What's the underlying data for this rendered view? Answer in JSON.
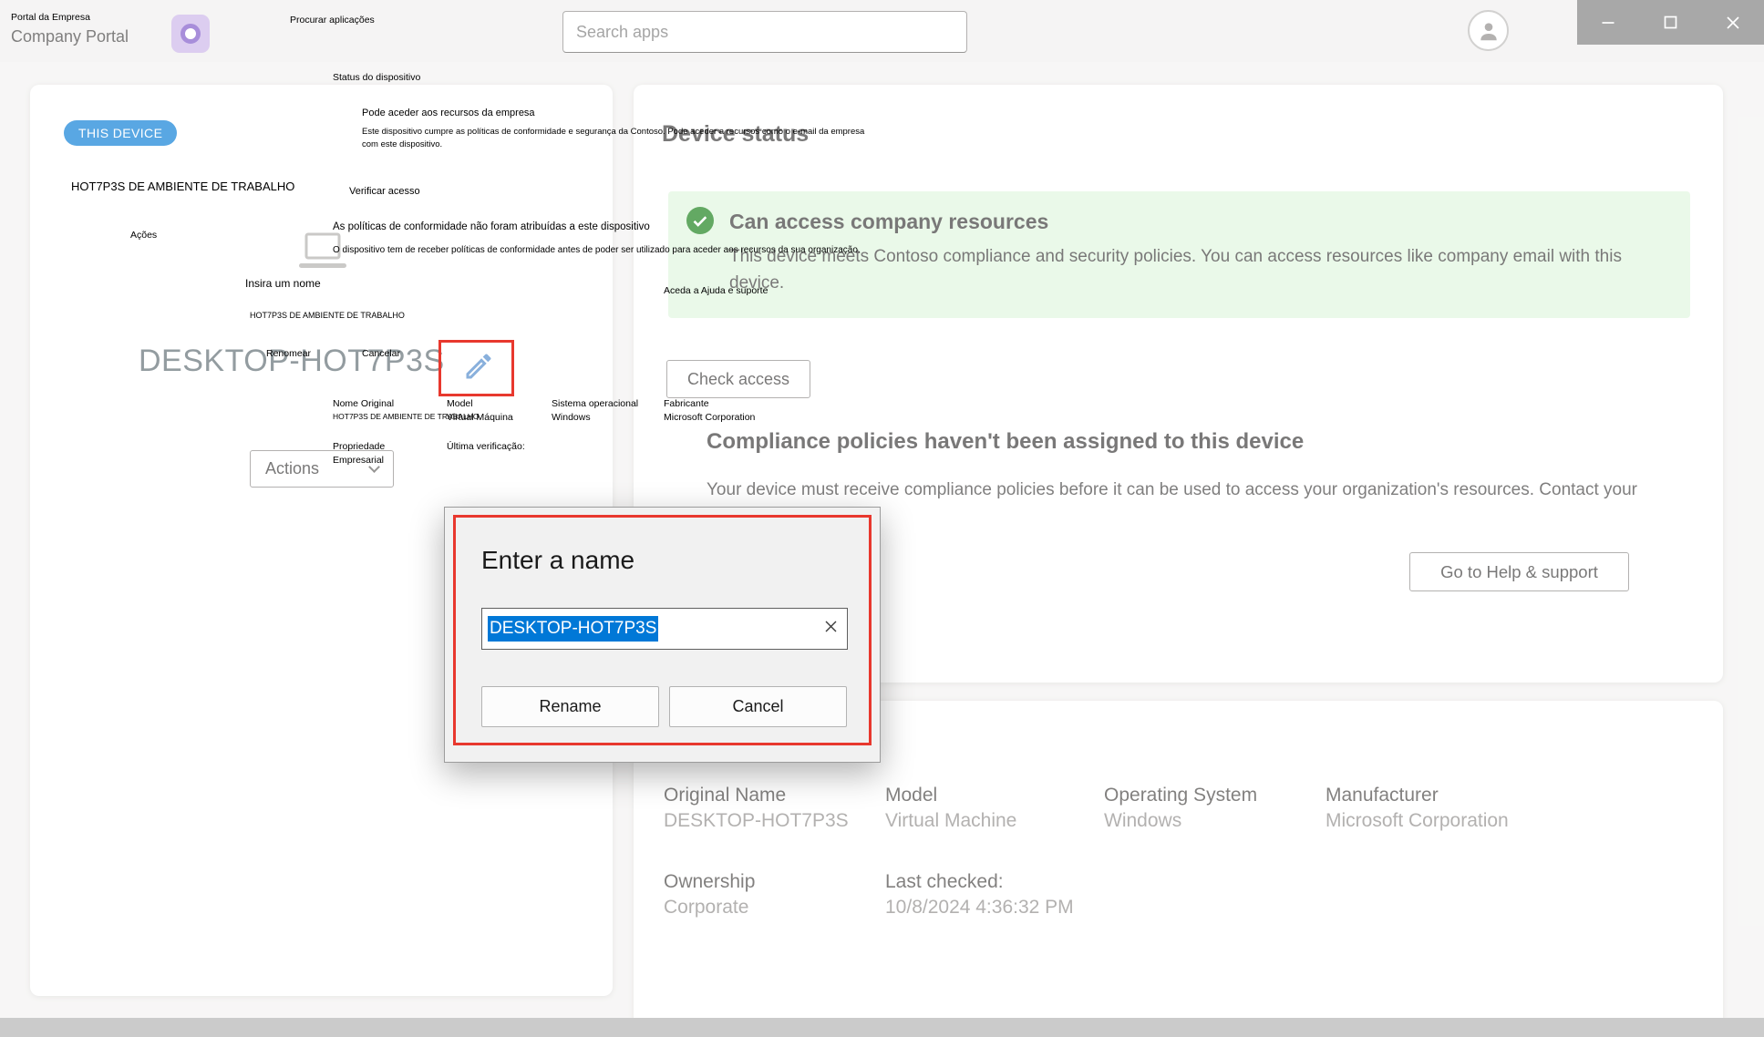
{
  "titlebar": {
    "portal_overlay_label": "Portal da Empresa",
    "app_name": "Company Portal",
    "search_overlay_label": "Procurar aplicações",
    "search_placeholder": "Search apps"
  },
  "device_card": {
    "badge": "THIS DEVICE",
    "device_name": "DESKTOP-HOT7P3S",
    "actions_button": "Actions"
  },
  "status_panel": {
    "heading": "Device status",
    "banner": {
      "title": "Can access company resources",
      "body": "This device meets Contoso compliance and security policies. You can access resources like company email with this device."
    },
    "check_access_button": "Check access",
    "compliance_title": "Compliance policies haven't been assigned to this device",
    "compliance_body": "Your device must receive compliance policies before it can be used to access your organization's resources. Contact your IT support person.",
    "help_button": "Go to Help & support"
  },
  "details_panel": {
    "original_name_label": "Original Name",
    "original_name_value": "DESKTOP-HOT7P3S",
    "model_label": "Model",
    "model_value": "Virtual Machine",
    "os_label": "Operating System",
    "os_value": "Windows",
    "manufacturer_label": "Manufacturer",
    "manufacturer_value": "Microsoft Corporation",
    "ownership_label": "Ownership",
    "ownership_value": "Corporate",
    "last_checked_label": "Last checked:",
    "last_checked_value": "10/8/2024 4:36:32 PM"
  },
  "rename_dialog": {
    "title": "Enter a name",
    "input_value": "DESKTOP-HOT7P3S",
    "rename_button": "Rename",
    "cancel_button": "Cancel"
  },
  "pt_overlay": {
    "status_dispositivo": "Status do dispositivo",
    "pode_aceder": "Pode aceder aos recursos da empresa",
    "este_dispositivo": "Este dispositivo cumpre as políticas de conformidade e segurança da Contoso. Pode aceder a recursos como o e-mail da empresa com este dispositivo.",
    "verificar_acesso": "Verificar acesso",
    "politicas_nao_atribuidas": "As políticas de conformidade não foram atribuídas a este dispositivo",
    "dispositivo_receber": "O dispositivo tem de receber políticas de conformidade antes de poder ser utilizado para aceder aos recursos da sua organização.",
    "aceda_ajuda": "Aceda a Ajuda e suporte",
    "device_name_header": "HOT7P3S DE AMBIENTE DE TRABALHO",
    "acoes": "Ações",
    "insira_um_nome": "Insira um nome",
    "device_name_small": "HOT7P3S DE AMBIENTE DE TRABALHO",
    "renomear": "Renomear",
    "cancelar": "Cancelar",
    "nome_original_label": "Nome Original",
    "nome_original_value": "HOT7P3S DE AMBIENTE DE TRABALHO",
    "model_label": "Model",
    "model_value": "Virtual  Máquina",
    "sistema_operacional_label": "Sistema operacional",
    "sistema_operacional_value": "Windows",
    "fabricante_label": "Fabricante",
    "fabricante_value": "Microsoft Corporation",
    "propriedade_label": "Propriedade",
    "propriedade_value": "Empresarial",
    "ultima_verificacao": "Última verificação:"
  },
  "colors": {
    "accent_blue": "#0078d4",
    "selection_blue": "#0078d7",
    "banner_green_bg": "#dff6dd",
    "check_green": "#107c10",
    "annotation_red": "#e8382e"
  }
}
